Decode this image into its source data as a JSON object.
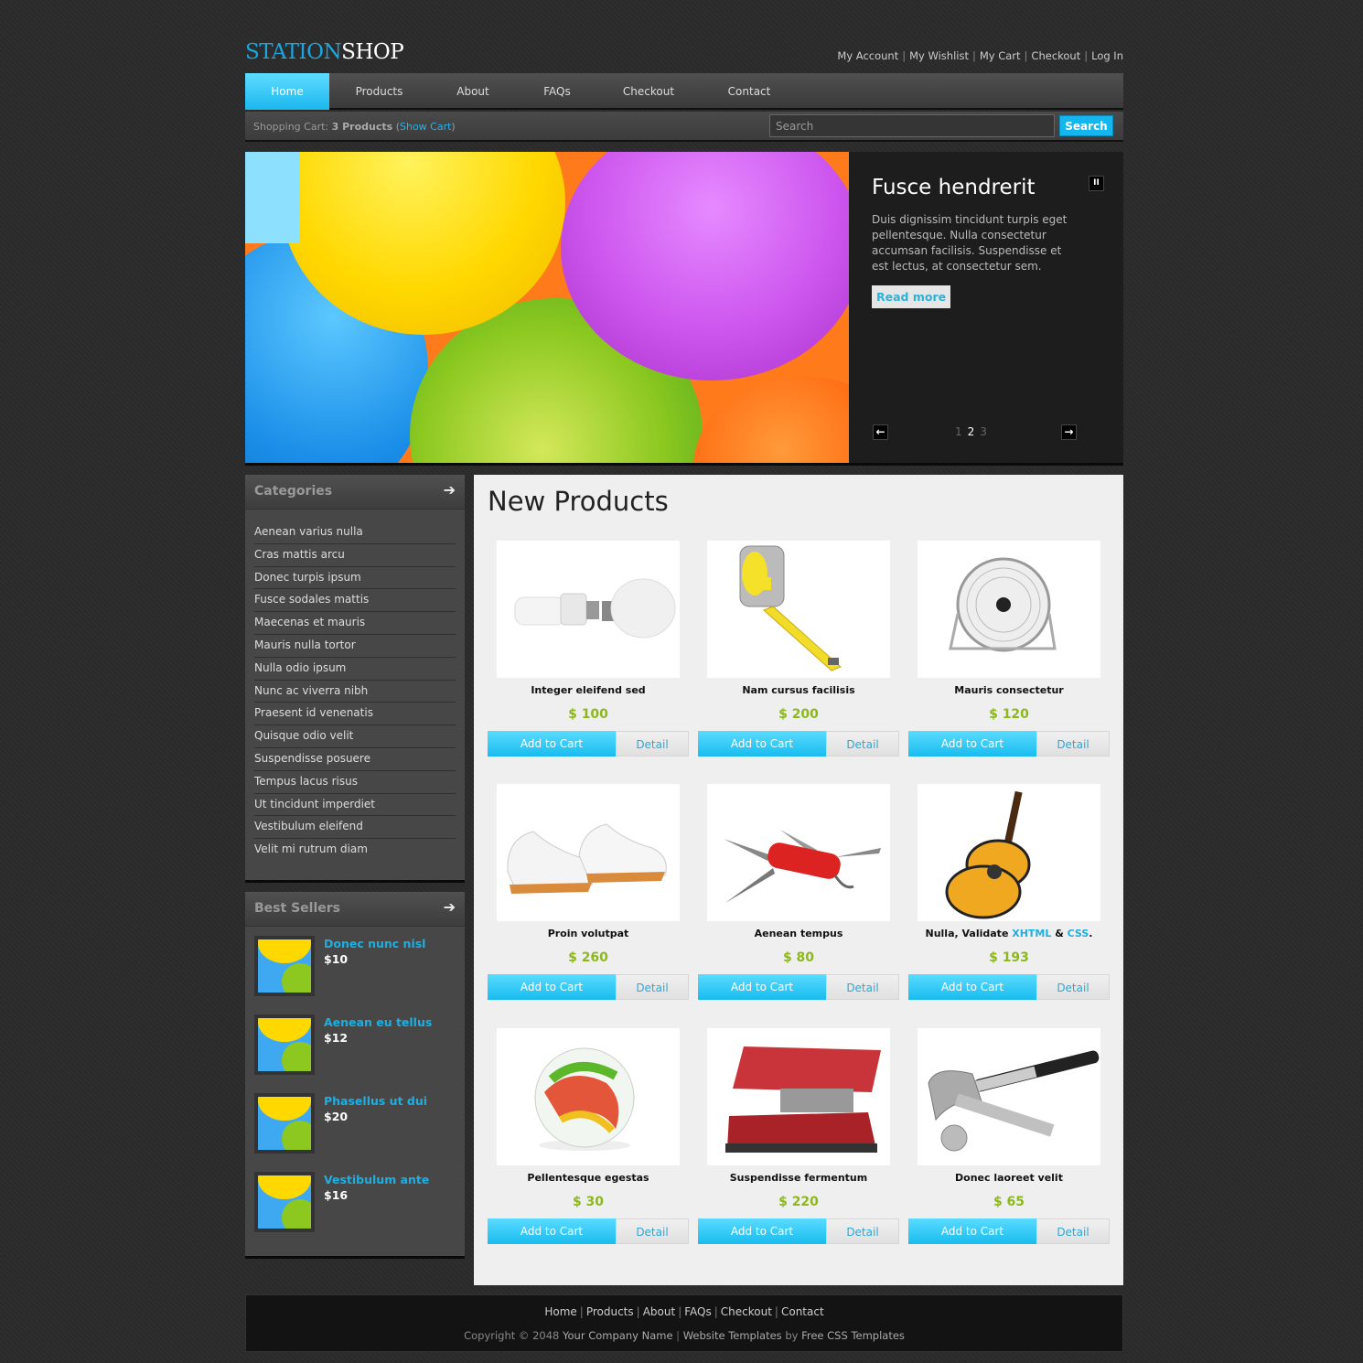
{
  "logo": {
    "part1": "STATION",
    "part2": "SHOP"
  },
  "top_links": [
    "My Account",
    "My Wishlist",
    "My Cart",
    "Checkout",
    "Log In"
  ],
  "nav": {
    "items": [
      "Home",
      "Products",
      "About",
      "FAQs",
      "Checkout",
      "Contact"
    ],
    "active": "Home"
  },
  "cart_bar": {
    "label": "Shopping Cart:",
    "count": "3 Products",
    "open_paren": "(",
    "show_cart": "Show Cart",
    "close_paren": ")"
  },
  "search": {
    "placeholder": "Search",
    "button": "Search"
  },
  "slider": {
    "title": "Fusce hendrerit",
    "description": "Duis dignissim tincidunt turpis eget pellentesque. Nulla consectetur accumsan facilisis. Suspendisse et est lectus, at consectetur sem.",
    "read_more": "Read more",
    "pause_icon": "pause-icon",
    "prev_icon": "arrow-left-icon",
    "next_icon": "arrow-right-icon",
    "pages": [
      "1",
      "2",
      "3"
    ],
    "current_page": "2"
  },
  "categories": {
    "title": "Categories",
    "items": [
      "Aenean varius nulla",
      "Cras mattis arcu",
      "Donec turpis ipsum",
      "Fusce sodales mattis",
      "Maecenas et mauris",
      "Mauris nulla tortor",
      "Nulla odio ipsum",
      "Nunc ac viverra nibh",
      "Praesent id venenatis",
      "Quisque odio velit",
      "Suspendisse posuere",
      "Tempus lacus risus",
      "Ut tincidunt imperdiet",
      "Vestibulum eleifend",
      "Velit mi rutrum diam"
    ]
  },
  "best_sellers": {
    "title": "Best Sellers",
    "items": [
      {
        "name": "Donec nunc nisl",
        "price": "$10"
      },
      {
        "name": "Aenean eu tellus",
        "price": "$12"
      },
      {
        "name": "Phasellus ut dui",
        "price": "$20"
      },
      {
        "name": "Vestibulum ante",
        "price": "$16"
      }
    ]
  },
  "new_products": {
    "title": "New Products",
    "add_to_cart": "Add to Cart",
    "detail": "Detail",
    "items": [
      {
        "name": "Integer eleifend sed",
        "price": "$ 100",
        "image": "light-bulbs"
      },
      {
        "name": "Nam cursus facilisis",
        "price": "$ 200",
        "image": "tape-measure"
      },
      {
        "name": "Mauris consectetur",
        "price": "$ 120",
        "image": "desk-fan"
      },
      {
        "name": "Proin volutpat",
        "price": "$ 260",
        "image": "shoes"
      },
      {
        "name": "Aenean tempus",
        "price": "$ 80",
        "image": "pocket-knife"
      },
      {
        "name_prefix": "Nulla, Validate ",
        "link1": "XHTML",
        "mid": " & ",
        "link2": "CSS",
        "suffix": ".",
        "price": "$ 193",
        "image": "guitar"
      },
      {
        "name": "Pellentesque egestas",
        "price": "$ 30",
        "image": "marble"
      },
      {
        "name": "Suspendisse fermentum",
        "price": "$ 220",
        "image": "stapler"
      },
      {
        "name": "Donec laoreet velit",
        "price": "$ 65",
        "image": "hammer-wrench"
      }
    ]
  },
  "footer": {
    "nav": [
      "Home",
      "Products",
      "About",
      "FAQs",
      "Checkout",
      "Contact"
    ],
    "copyright_prefix": "Copyright © 2048",
    "company": "Your Company Name",
    "templates": "Website Templates",
    "by": "by",
    "provider": "Free CSS Templates"
  },
  "colors": {
    "accent": "#1ab8ee",
    "price": "#8cb81c",
    "link": "#1eaee0"
  }
}
